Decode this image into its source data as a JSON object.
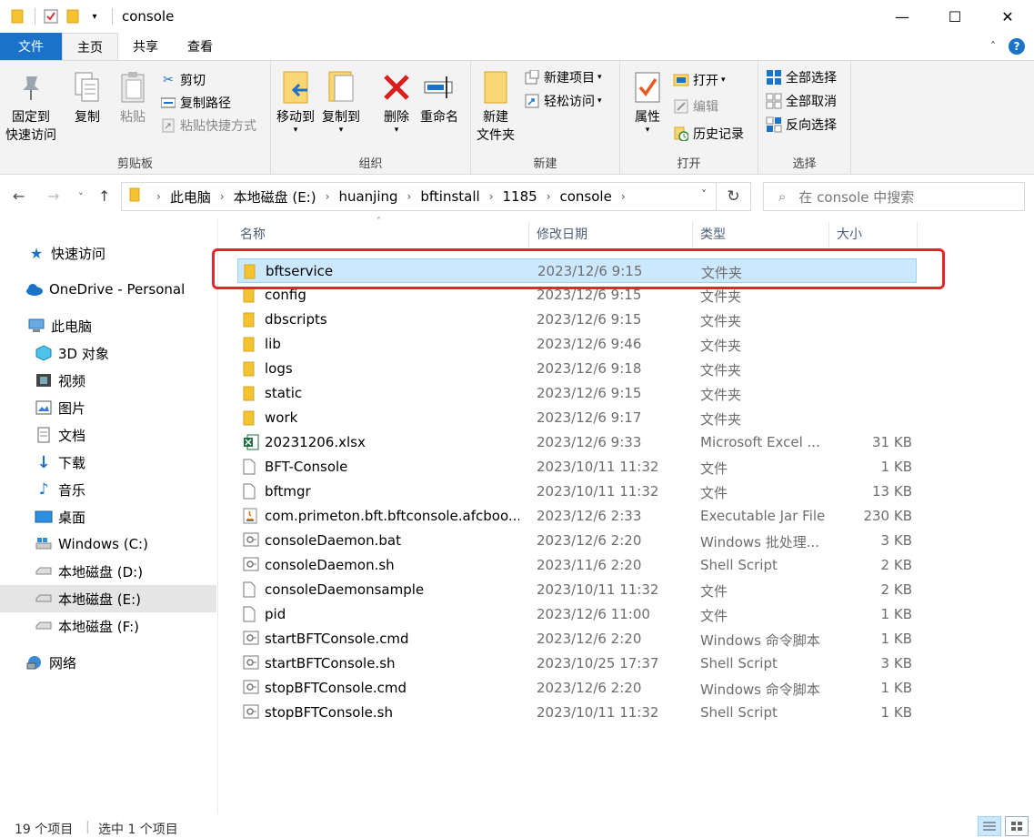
{
  "window": {
    "title": "console",
    "minimize": "—",
    "maximize": "☐",
    "close": "✕"
  },
  "tabs": [
    {
      "label": "文件"
    },
    {
      "label": "主页"
    },
    {
      "label": "共享"
    },
    {
      "label": "查看"
    }
  ],
  "ribbon": {
    "clipboard": {
      "label": "剪贴板",
      "pin": "固定到\n快速访问",
      "copy": "复制",
      "paste": "粘贴",
      "cut": "剪切",
      "copy_path": "复制路径",
      "paste_shortcut": "粘贴快捷方式"
    },
    "organize": {
      "label": "组织",
      "move_to": "移动到",
      "copy_to": "复制到",
      "delete": "删除",
      "rename": "重命名"
    },
    "new": {
      "label": "新建",
      "new_folder": "新建\n文件夹",
      "new_item": "新建项目",
      "easy_access": "轻松访问"
    },
    "open": {
      "label": "打开",
      "properties": "属性",
      "open": "打开",
      "edit": "编辑",
      "history": "历史记录"
    },
    "select": {
      "label": "选择",
      "select_all": "全部选择",
      "select_none": "全部取消",
      "invert": "反向选择"
    }
  },
  "address": {
    "crumbs": [
      "此电脑",
      "本地磁盘 (E:)",
      "huanjing",
      "bftinstall",
      "1185",
      "console"
    ],
    "search_placeholder": "在 console 中搜索"
  },
  "sidebar": {
    "items": [
      {
        "label": "快速访问"
      },
      {
        "label": "OneDrive - Personal"
      },
      {
        "label": "此电脑"
      },
      {
        "label": "3D 对象"
      },
      {
        "label": "视频"
      },
      {
        "label": "图片"
      },
      {
        "label": "文档"
      },
      {
        "label": "下载"
      },
      {
        "label": "音乐"
      },
      {
        "label": "桌面"
      },
      {
        "label": "Windows  (C:)"
      },
      {
        "label": "本地磁盘 (D:)"
      },
      {
        "label": "本地磁盘 (E:)"
      },
      {
        "label": "本地磁盘 (F:)"
      },
      {
        "label": "网络"
      }
    ]
  },
  "columns": {
    "name": "名称",
    "date": "修改日期",
    "type": "类型",
    "size": "大小"
  },
  "files": [
    {
      "name": "bftservice",
      "date": "2023/12/6 9:15",
      "type": "文件夹",
      "size": "",
      "icon": "folder-icon"
    },
    {
      "name": "config",
      "date": "2023/12/6 9:15",
      "type": "文件夹",
      "size": "",
      "icon": "folder-icon"
    },
    {
      "name": "dbscripts",
      "date": "2023/12/6 9:15",
      "type": "文件夹",
      "size": "",
      "icon": "folder-icon"
    },
    {
      "name": "lib",
      "date": "2023/12/6 9:46",
      "type": "文件夹",
      "size": "",
      "icon": "folder-icon"
    },
    {
      "name": "logs",
      "date": "2023/12/6 9:18",
      "type": "文件夹",
      "size": "",
      "icon": "folder-icon"
    },
    {
      "name": "static",
      "date": "2023/12/6 9:15",
      "type": "文件夹",
      "size": "",
      "icon": "folder-icon"
    },
    {
      "name": "work",
      "date": "2023/12/6 9:17",
      "type": "文件夹",
      "size": "",
      "icon": "folder-icon"
    },
    {
      "name": "20231206.xlsx",
      "date": "2023/12/6 9:33",
      "type": "Microsoft Excel ...",
      "size": "31 KB",
      "icon": "excel-icon"
    },
    {
      "name": "BFT-Console",
      "date": "2023/10/11 11:32",
      "type": "文件",
      "size": "1 KB",
      "icon": "file-icon"
    },
    {
      "name": "bftmgr",
      "date": "2023/10/11 11:32",
      "type": "文件",
      "size": "13 KB",
      "icon": "file-icon"
    },
    {
      "name": "com.primeton.bft.bftconsole.afcboo...",
      "date": "2023/12/6 2:33",
      "type": "Executable Jar File",
      "size": "230 KB",
      "icon": "java-icon"
    },
    {
      "name": "consoleDaemon.bat",
      "date": "2023/12/6 2:20",
      "type": "Windows 批处理...",
      "size": "3 KB",
      "icon": "script-icon"
    },
    {
      "name": "consoleDaemon.sh",
      "date": "2023/11/6 2:20",
      "type": "Shell Script",
      "size": "2 KB",
      "icon": "script-icon"
    },
    {
      "name": "consoleDaemonsample",
      "date": "2023/10/11 11:32",
      "type": "文件",
      "size": "2 KB",
      "icon": "file-icon"
    },
    {
      "name": "pid",
      "date": "2023/12/6 11:00",
      "type": "文件",
      "size": "1 KB",
      "icon": "file-icon"
    },
    {
      "name": "startBFTConsole.cmd",
      "date": "2023/12/6 2:20",
      "type": "Windows 命令脚本",
      "size": "1 KB",
      "icon": "script-icon"
    },
    {
      "name": "startBFTConsole.sh",
      "date": "2023/10/25 17:37",
      "type": "Shell Script",
      "size": "3 KB",
      "icon": "script-icon"
    },
    {
      "name": "stopBFTConsole.cmd",
      "date": "2023/12/6 2:20",
      "type": "Windows 命令脚本",
      "size": "1 KB",
      "icon": "script-icon"
    },
    {
      "name": "stopBFTConsole.sh",
      "date": "2023/10/11 11:32",
      "type": "Shell Script",
      "size": "1 KB",
      "icon": "script-icon"
    }
  ],
  "status": {
    "count": "19 个项目",
    "selected": "选中 1 个项目"
  },
  "colors": {
    "accent": "#1a73c8",
    "selection": "#cce8ff",
    "highlight_box": "#e8232a",
    "folder": "#f4c430"
  }
}
